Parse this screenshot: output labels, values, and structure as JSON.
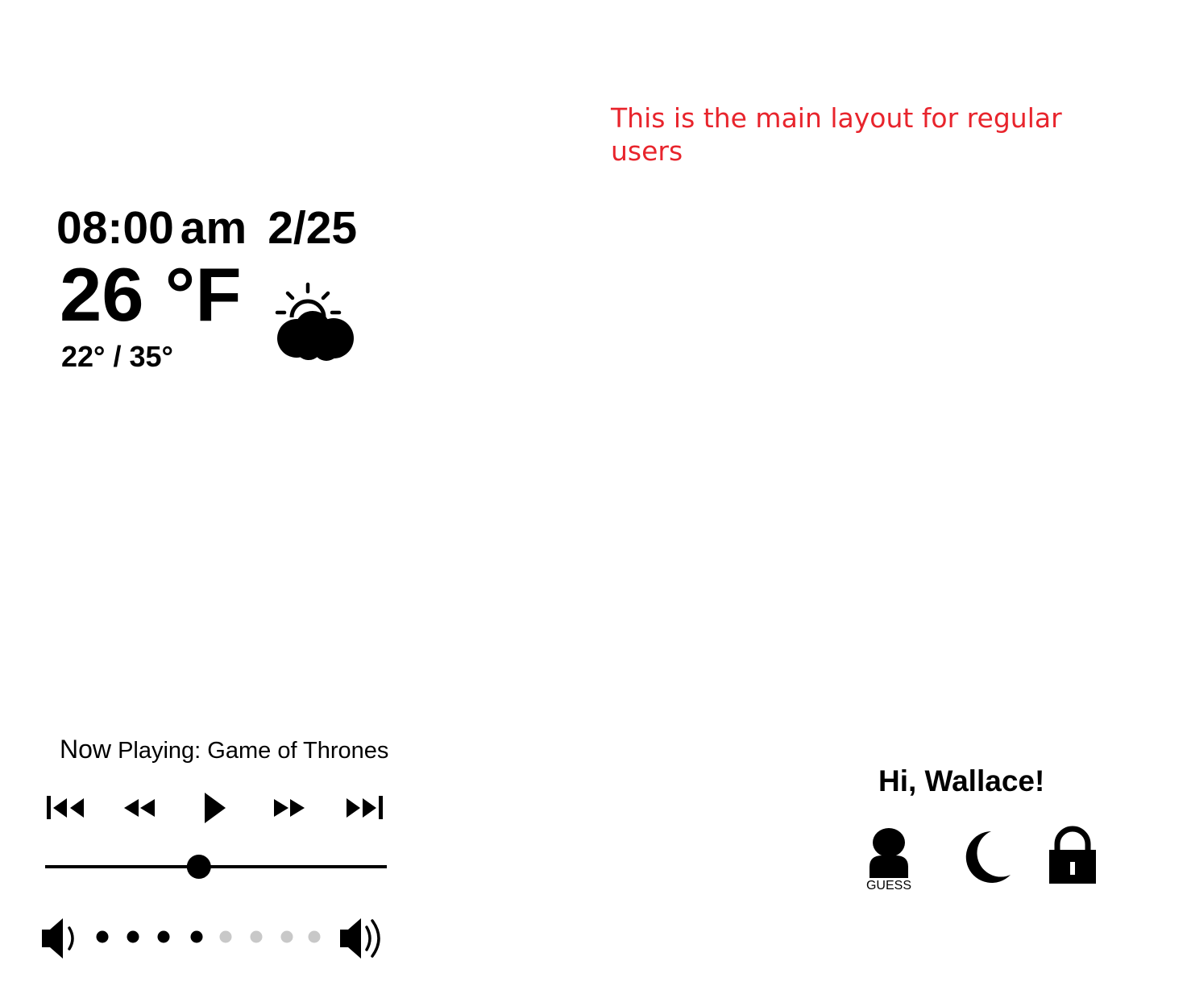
{
  "annotation": {
    "line1": "This is the main layout for regular",
    "line2": "users"
  },
  "clock": {
    "time": "08:00",
    "ampm": "am",
    "date": "2/25"
  },
  "weather": {
    "temperature": "26 °F",
    "low": "22°",
    "separator": " / ",
    "high": "35°",
    "icon": "partly-cloudy-icon"
  },
  "player": {
    "now_playing_lead": "Now",
    "now_playing_rest": " Playing: Game of Thrones",
    "controls": [
      "skip-previous-icon",
      "rewind-icon",
      "play-icon",
      "fast-forward-icon",
      "skip-next-icon"
    ],
    "seek_progress": 0.45,
    "volume_level": 4,
    "volume_max": 8,
    "volume_active_color": "#000000",
    "volume_inactive_color": "#c8c8c8"
  },
  "user": {
    "greeting": "Hi, Wallace!",
    "guest_label": "GUESS",
    "icons": [
      "user-icon",
      "moon-icon",
      "lock-icon"
    ]
  }
}
